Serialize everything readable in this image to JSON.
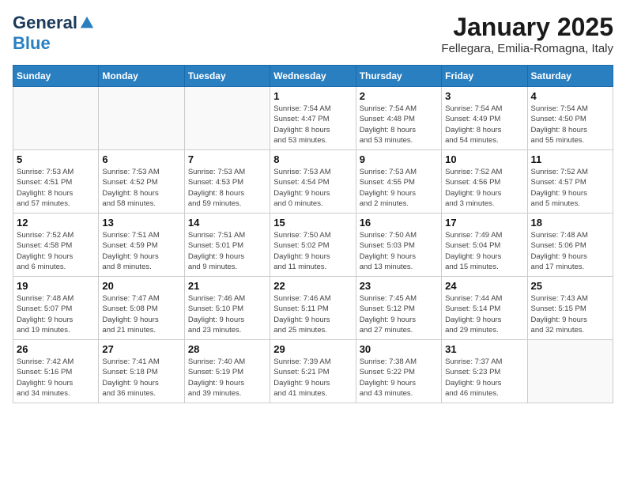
{
  "header": {
    "logo_general": "General",
    "logo_blue": "Blue",
    "calendar_title": "January 2025",
    "calendar_subtitle": "Fellegara, Emilia-Romagna, Italy"
  },
  "weekdays": [
    "Sunday",
    "Monday",
    "Tuesday",
    "Wednesday",
    "Thursday",
    "Friday",
    "Saturday"
  ],
  "weeks": [
    [
      {
        "day": "",
        "info": ""
      },
      {
        "day": "",
        "info": ""
      },
      {
        "day": "",
        "info": ""
      },
      {
        "day": "1",
        "info": "Sunrise: 7:54 AM\nSunset: 4:47 PM\nDaylight: 8 hours\nand 53 minutes."
      },
      {
        "day": "2",
        "info": "Sunrise: 7:54 AM\nSunset: 4:48 PM\nDaylight: 8 hours\nand 53 minutes."
      },
      {
        "day": "3",
        "info": "Sunrise: 7:54 AM\nSunset: 4:49 PM\nDaylight: 8 hours\nand 54 minutes."
      },
      {
        "day": "4",
        "info": "Sunrise: 7:54 AM\nSunset: 4:50 PM\nDaylight: 8 hours\nand 55 minutes."
      }
    ],
    [
      {
        "day": "5",
        "info": "Sunrise: 7:53 AM\nSunset: 4:51 PM\nDaylight: 8 hours\nand 57 minutes."
      },
      {
        "day": "6",
        "info": "Sunrise: 7:53 AM\nSunset: 4:52 PM\nDaylight: 8 hours\nand 58 minutes."
      },
      {
        "day": "7",
        "info": "Sunrise: 7:53 AM\nSunset: 4:53 PM\nDaylight: 8 hours\nand 59 minutes."
      },
      {
        "day": "8",
        "info": "Sunrise: 7:53 AM\nSunset: 4:54 PM\nDaylight: 9 hours\nand 0 minutes."
      },
      {
        "day": "9",
        "info": "Sunrise: 7:53 AM\nSunset: 4:55 PM\nDaylight: 9 hours\nand 2 minutes."
      },
      {
        "day": "10",
        "info": "Sunrise: 7:52 AM\nSunset: 4:56 PM\nDaylight: 9 hours\nand 3 minutes."
      },
      {
        "day": "11",
        "info": "Sunrise: 7:52 AM\nSunset: 4:57 PM\nDaylight: 9 hours\nand 5 minutes."
      }
    ],
    [
      {
        "day": "12",
        "info": "Sunrise: 7:52 AM\nSunset: 4:58 PM\nDaylight: 9 hours\nand 6 minutes."
      },
      {
        "day": "13",
        "info": "Sunrise: 7:51 AM\nSunset: 4:59 PM\nDaylight: 9 hours\nand 8 minutes."
      },
      {
        "day": "14",
        "info": "Sunrise: 7:51 AM\nSunset: 5:01 PM\nDaylight: 9 hours\nand 9 minutes."
      },
      {
        "day": "15",
        "info": "Sunrise: 7:50 AM\nSunset: 5:02 PM\nDaylight: 9 hours\nand 11 minutes."
      },
      {
        "day": "16",
        "info": "Sunrise: 7:50 AM\nSunset: 5:03 PM\nDaylight: 9 hours\nand 13 minutes."
      },
      {
        "day": "17",
        "info": "Sunrise: 7:49 AM\nSunset: 5:04 PM\nDaylight: 9 hours\nand 15 minutes."
      },
      {
        "day": "18",
        "info": "Sunrise: 7:48 AM\nSunset: 5:06 PM\nDaylight: 9 hours\nand 17 minutes."
      }
    ],
    [
      {
        "day": "19",
        "info": "Sunrise: 7:48 AM\nSunset: 5:07 PM\nDaylight: 9 hours\nand 19 minutes."
      },
      {
        "day": "20",
        "info": "Sunrise: 7:47 AM\nSunset: 5:08 PM\nDaylight: 9 hours\nand 21 minutes."
      },
      {
        "day": "21",
        "info": "Sunrise: 7:46 AM\nSunset: 5:10 PM\nDaylight: 9 hours\nand 23 minutes."
      },
      {
        "day": "22",
        "info": "Sunrise: 7:46 AM\nSunset: 5:11 PM\nDaylight: 9 hours\nand 25 minutes."
      },
      {
        "day": "23",
        "info": "Sunrise: 7:45 AM\nSunset: 5:12 PM\nDaylight: 9 hours\nand 27 minutes."
      },
      {
        "day": "24",
        "info": "Sunrise: 7:44 AM\nSunset: 5:14 PM\nDaylight: 9 hours\nand 29 minutes."
      },
      {
        "day": "25",
        "info": "Sunrise: 7:43 AM\nSunset: 5:15 PM\nDaylight: 9 hours\nand 32 minutes."
      }
    ],
    [
      {
        "day": "26",
        "info": "Sunrise: 7:42 AM\nSunset: 5:16 PM\nDaylight: 9 hours\nand 34 minutes."
      },
      {
        "day": "27",
        "info": "Sunrise: 7:41 AM\nSunset: 5:18 PM\nDaylight: 9 hours\nand 36 minutes."
      },
      {
        "day": "28",
        "info": "Sunrise: 7:40 AM\nSunset: 5:19 PM\nDaylight: 9 hours\nand 39 minutes."
      },
      {
        "day": "29",
        "info": "Sunrise: 7:39 AM\nSunset: 5:21 PM\nDaylight: 9 hours\nand 41 minutes."
      },
      {
        "day": "30",
        "info": "Sunrise: 7:38 AM\nSunset: 5:22 PM\nDaylight: 9 hours\nand 43 minutes."
      },
      {
        "day": "31",
        "info": "Sunrise: 7:37 AM\nSunset: 5:23 PM\nDaylight: 9 hours\nand 46 minutes."
      },
      {
        "day": "",
        "info": ""
      }
    ]
  ]
}
